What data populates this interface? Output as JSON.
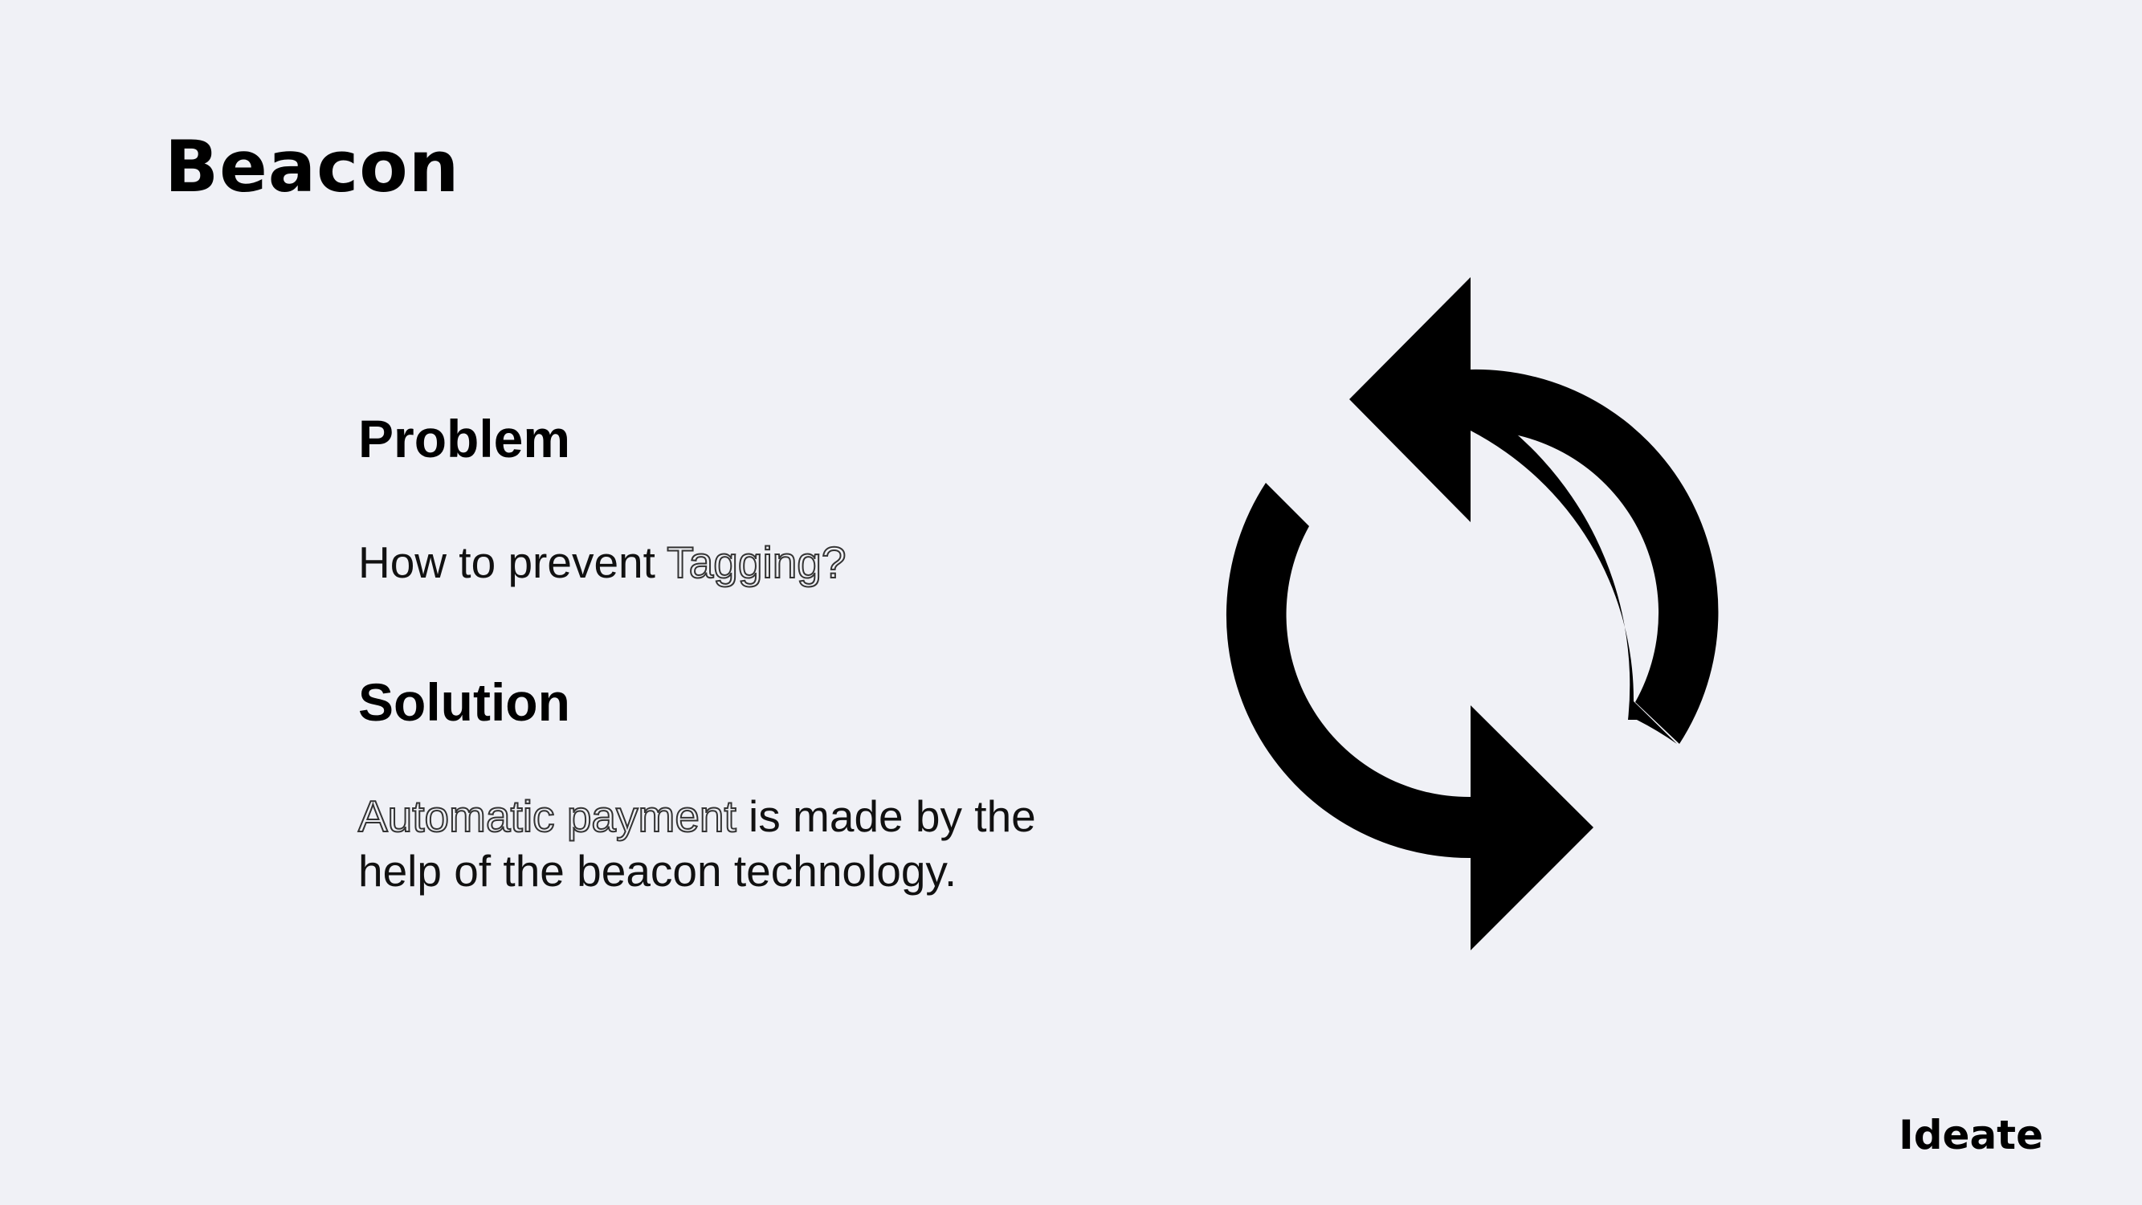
{
  "slide": {
    "title": "Beacon",
    "problem": {
      "heading": "Problem",
      "text_prefix": "How to prevent ",
      "text_emphasis": "Tagging?"
    },
    "solution": {
      "heading": "Solution",
      "text_emphasis": "Automatic payment",
      "text_rest": " is made by the help of the beacon technology."
    },
    "icon": "refresh-arrows-icon",
    "footer": "Ideate"
  },
  "colors": {
    "background": "#f0f1f6",
    "text": "#000000"
  }
}
